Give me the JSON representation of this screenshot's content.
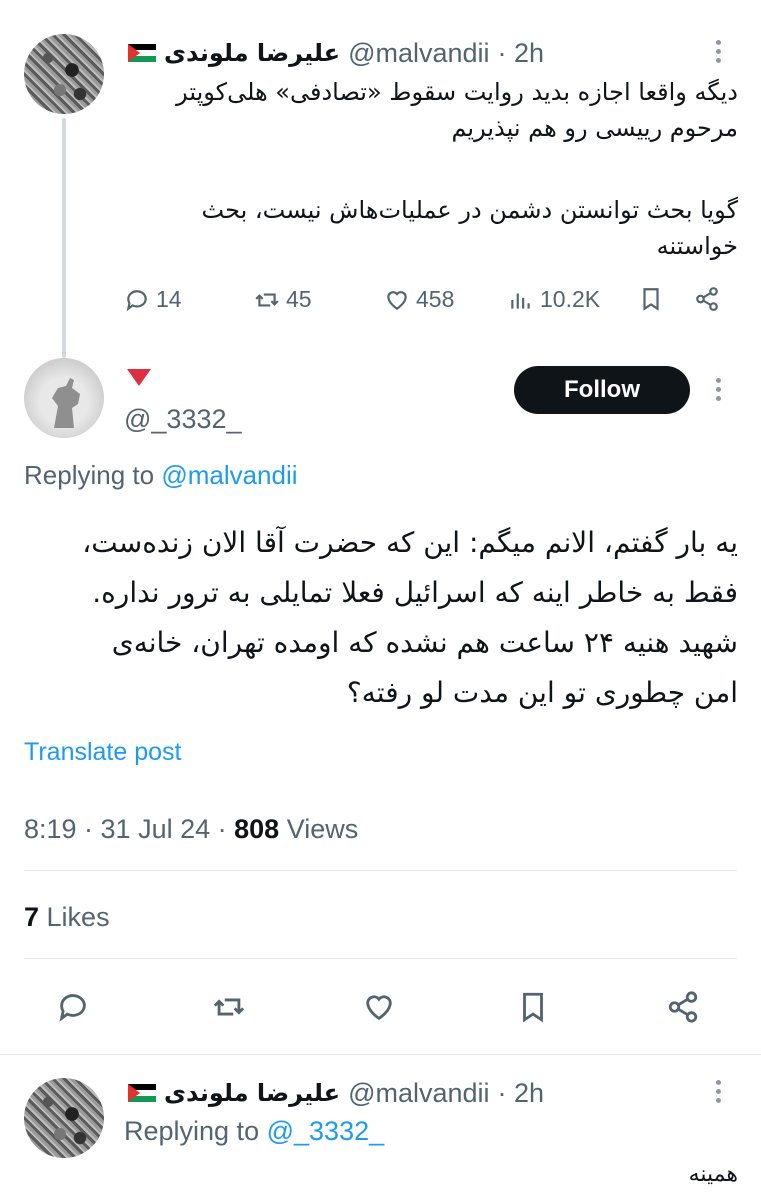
{
  "tweet1": {
    "display_name": "علیرضا ملوندی",
    "flag_icon": "palestine-flag-icon",
    "handle": "@malvandii",
    "time": "· 2h",
    "text_lines": [
      "دیگه واقعا اجازه بدید روایت سقوط «تصادفی» هلی‌کوپتر",
      "مرحوم رییسی رو هم نپذیریم",
      "گویا بحث توانستن دشمن در عملیات‌هاش نیست، بحث",
      "خواستنه"
    ],
    "replies": "14",
    "reposts": "45",
    "likes": "458",
    "views": "10.2K"
  },
  "tweet2": {
    "display_name_icon": "red-triangle-icon",
    "handle": "@_3332_",
    "follow_label": "Follow",
    "replying_prefix": "Replying to",
    "replying_to": "@malvandii",
    "text_lines": [
      "یه بار گفتم، الانم میگم: این که حضرت آقا الان زنده‌ست،",
      "فقط به خاطر اینه که اسرائیل فعلا تمایلی به ترور نداره.",
      "شهید هنیه ۲۴ ساعت هم نشده که اومده تهران، خانه‌ی",
      "امن چطوری تو این مدت لو رفته؟"
    ],
    "translate_label": "Translate post",
    "timestamp": "8:19 · 31 Jul 24 · ",
    "views_count": "808",
    "views_label": " Views",
    "likes_count": "7",
    "likes_label": " Likes"
  },
  "tweet3": {
    "display_name": "علیرضا ملوندی",
    "flag_icon": "palestine-flag-icon",
    "handle": "@malvandii",
    "time": "· 2h",
    "replying_prefix": "Replying to",
    "replying_to": "@_3332_",
    "text": "همینه"
  },
  "colors": {
    "accent": "#1d9bf0",
    "text": "#0f1419",
    "secondary": "#536471",
    "divider": "#e3e8ec"
  }
}
